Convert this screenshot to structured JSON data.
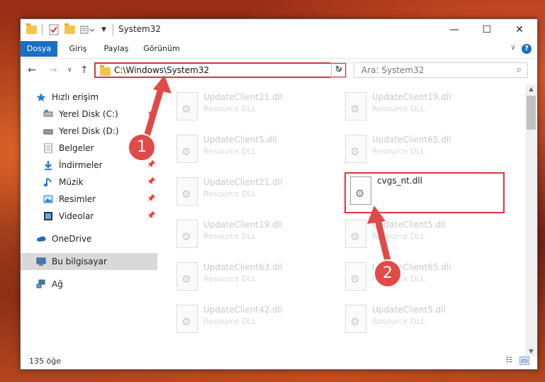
{
  "window": {
    "title": "System32",
    "minimize_label": "—",
    "maximize_label": "☐",
    "close_label": "✕"
  },
  "ribbon": {
    "tabs": [
      "Dosya",
      "Giriş",
      "Paylaş",
      "Görünüm"
    ],
    "help_label": "?",
    "collapse_label": "∨"
  },
  "nav": {
    "back_label": "←",
    "forward_label": "→",
    "recent_label": "∨",
    "up_label": "↑",
    "address": "C:\\Windows\\System32",
    "address_dropdown": "∨",
    "refresh_label": "↻",
    "search_placeholder": "Ara: System32",
    "search_icon": "⌕"
  },
  "sidebar": {
    "items": [
      {
        "label": "Hızlı erişim",
        "icon": "star-icon"
      },
      {
        "label": "Yerel Disk (C:)",
        "icon": "drive-icon"
      },
      {
        "label": "Yerel Disk (D:)",
        "icon": "drive-icon"
      },
      {
        "label": "Belgeler",
        "icon": "documents-icon"
      },
      {
        "label": "İndirmeler",
        "icon": "download-icon"
      },
      {
        "label": "Müzik",
        "icon": "music-icon"
      },
      {
        "label": "Resimler",
        "icon": "pictures-icon"
      },
      {
        "label": "Videolar",
        "icon": "videos-icon"
      },
      {
        "label": "OneDrive",
        "icon": "cloud-icon"
      },
      {
        "label": "Bu bilgisayar",
        "icon": "computer-icon"
      },
      {
        "label": "Ağ",
        "icon": "network-icon"
      }
    ],
    "pin_glyph": "📌"
  },
  "files": [
    {
      "name": "UpdateClient21.dll",
      "type": "Resource DLL"
    },
    {
      "name": "UpdateClient19.dll",
      "type": "Resource DLL"
    },
    {
      "name": "UpdateClient5.dll",
      "type": "Resource DLL"
    },
    {
      "name": "UpdateClient65.dll",
      "type": "Resource DLL"
    },
    {
      "name": "UpdateClient21.dll",
      "type": "Resource DLL"
    },
    {
      "name": "cvgs_nt.dll",
      "type": ""
    },
    {
      "name": "UpdateClient19.dll",
      "type": "Resource DLL"
    },
    {
      "name": "UpdateClient5.dll",
      "type": "Resource DLL"
    },
    {
      "name": "UpdateClient63.dll",
      "type": "Resource DLL"
    },
    {
      "name": "UpdateClient65.dll",
      "type": "Resource DLL"
    },
    {
      "name": "UpdateClient42.dll",
      "type": "Resource DLL"
    },
    {
      "name": "UpdateClient5.dll",
      "type": "Resource DLL"
    }
  ],
  "status": {
    "item_count": "135 öğe"
  },
  "annotations": {
    "callout_1": "1",
    "callout_2": "2",
    "accent_color": "#e04a47"
  }
}
